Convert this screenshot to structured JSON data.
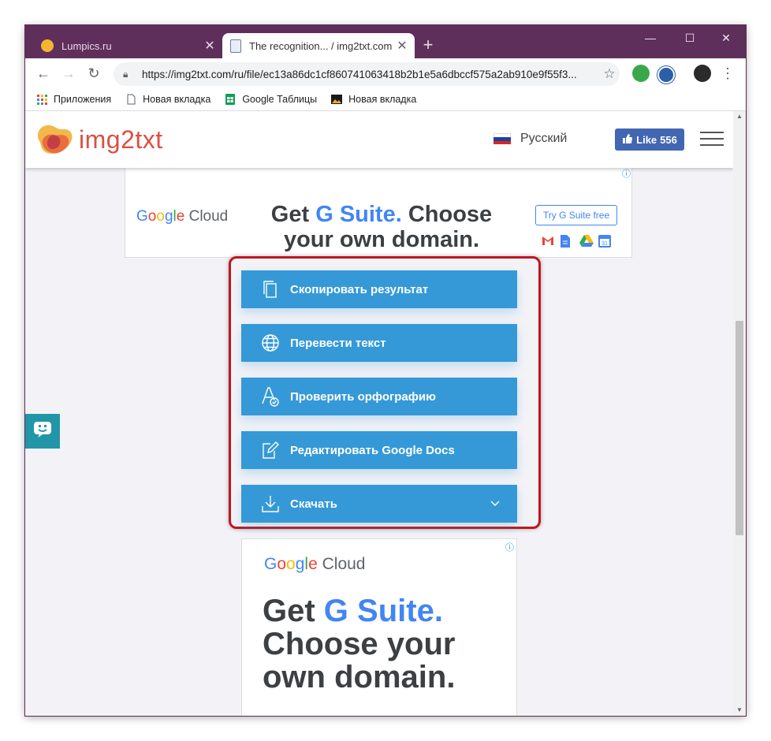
{
  "tabs": [
    {
      "title": "Lumpics.ru",
      "favicon_color": "#f5b52e",
      "active": false
    },
    {
      "title": "The recognition... / img2txt.com",
      "active": true
    }
  ],
  "window_controls": {
    "minimize": "—",
    "maximize": "☐",
    "close": "✕"
  },
  "address_bar": {
    "url": "https://img2txt.com/ru/file/ec13a86dc1cf860741063418b2b1e5a6dbccf575a2ab910e9f55f3..."
  },
  "bookmarks": [
    {
      "label": "Приложения",
      "icon": "apps-grid-icon"
    },
    {
      "label": "Новая вкладка",
      "icon": "page-icon"
    },
    {
      "label": "Google Таблицы",
      "icon": "sheets-icon"
    },
    {
      "label": "Новая вкладка",
      "icon": "image-icon"
    }
  ],
  "site": {
    "logo_text": "img2txt",
    "language": "Русский",
    "like_label": "Like",
    "like_count": "556"
  },
  "ad_top": {
    "brand_words": [
      "G",
      "o",
      "o",
      "g",
      "l",
      "e"
    ],
    "brand_suffix": "Cloud",
    "headline_pre": "Get ",
    "headline_accent": "G Suite.",
    "headline_post": " Choose your own domain.",
    "cta": "Try G Suite free",
    "info": "ⓘ"
  },
  "actions": [
    {
      "label": "Скопировать результат",
      "icon": "copy-icon"
    },
    {
      "label": "Перевести текст",
      "icon": "globe-icon"
    },
    {
      "label": "Проверить орфографию",
      "icon": "spellcheck-icon"
    },
    {
      "label": "Редактировать Google Docs",
      "icon": "edit-doc-icon"
    },
    {
      "label": "Скачать",
      "icon": "download-icon",
      "dropdown": true
    }
  ],
  "ad_bottom": {
    "brand_suffix": "Cloud",
    "headline_pre": "Get ",
    "headline_accent": "G Suite.",
    "headline_post": "Choose your own domain.",
    "info": "ⓘ"
  },
  "colors": {
    "browser_frame": "#5f2f5c",
    "action_button": "#3599d8",
    "highlight_border": "#c0161f",
    "logo_text": "#de4e43",
    "facebook": "#4267b2"
  }
}
